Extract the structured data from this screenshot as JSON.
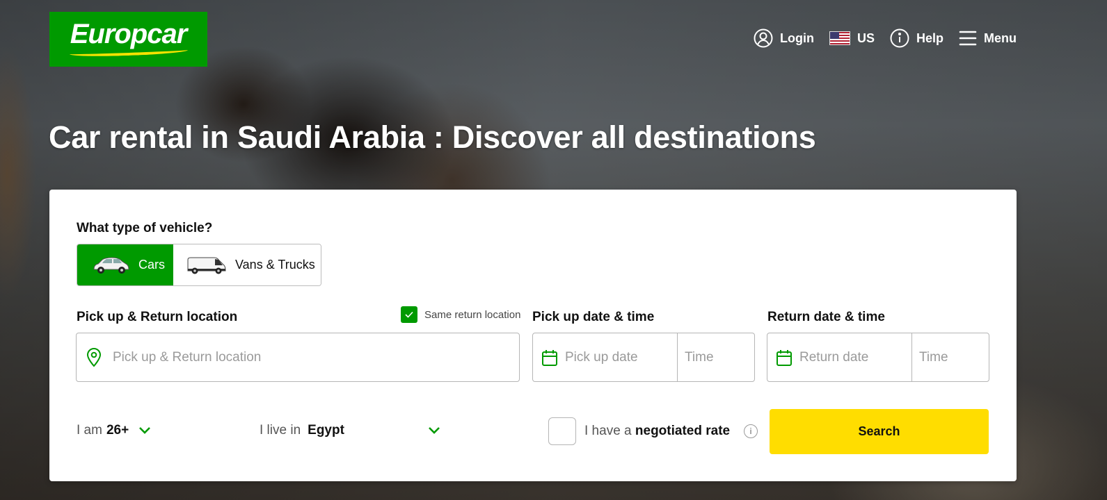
{
  "header": {
    "logo_text": "Europcar",
    "nav": {
      "login": "Login",
      "locale": "US",
      "help": "Help",
      "menu": "Menu"
    }
  },
  "hero": {
    "headline": "Car rental in Saudi Arabia : Discover all destinations"
  },
  "booking": {
    "vehicle_question": "What type of vehicle?",
    "vehicle_types": {
      "cars": "Cars",
      "vans": "Vans & Trucks",
      "selected": "Cars"
    },
    "location_label": "Pick up & Return location",
    "same_return_label": "Same return location",
    "same_return_checked": true,
    "location_placeholder": "Pick up & Return location",
    "pickup_label": "Pick up date & time",
    "pickup_date_placeholder": "Pick up date",
    "pickup_time_placeholder": "Time",
    "return_label": "Return date & time",
    "return_date_placeholder": "Return date",
    "return_time_placeholder": "Time",
    "age_prefix": "I am",
    "age_value": "26+",
    "country_prefix": "I live in",
    "country_value": "Egypt",
    "negotiated_prefix": "I have a",
    "negotiated_bold": "negotiated rate",
    "negotiated_checked": false,
    "search_label": "Search"
  },
  "colors": {
    "brand_green": "#009a00",
    "brand_yellow": "#ffdd00",
    "logo_swoosh": "#f5e200"
  }
}
